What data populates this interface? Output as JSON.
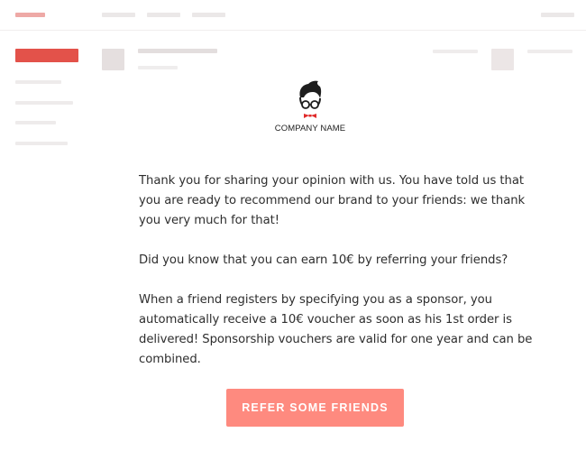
{
  "wireframe": {
    "top_nav_placeholders": 5,
    "sidebar_placeholders": 5,
    "header_placeholders": 5
  },
  "colors": {
    "accent_red": "#e3524a",
    "accent_red_light": "#eea9a6",
    "placeholder_grey": "#e6e2e2",
    "cta_background": "#fe8a7f",
    "cta_text": "#ffffff",
    "body_text": "#2e2e2e",
    "bow_tie": "#e02b2b"
  },
  "email": {
    "logo": {
      "icon": "nerd-mascot-icon",
      "company_name": "COMPANY NAME"
    },
    "paragraphs": [
      "Thank you for sharing your opinion with us. You have told us that you are ready to recommend our brand to your friends: we thank you very much for that!",
      "Did you know that you can earn 10€ by referring your friends?",
      "When a friend registers by specifying you as a sponsor, you automatically receive a 10€ voucher as soon as his 1st order is delivered! Sponsorship vouchers are valid for one year and can be combined."
    ],
    "cta_label": "REFER SOME FRIENDS"
  }
}
